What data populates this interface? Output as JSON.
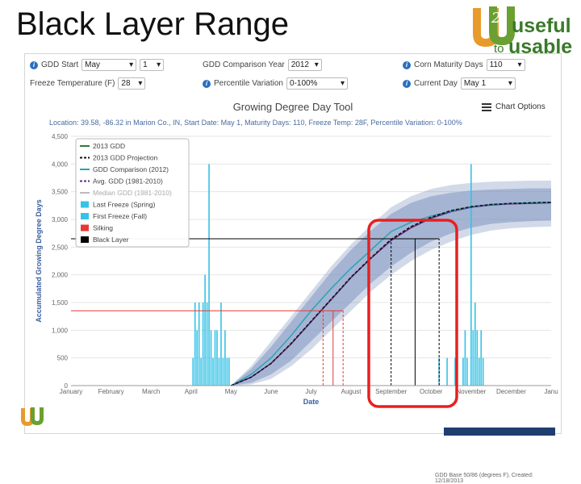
{
  "slide": {
    "title": "Black Layer Range"
  },
  "logo": {
    "word1": "useful",
    "word2": "to",
    "word3": "usable"
  },
  "controls": {
    "gdd_start_label": "GDD Start",
    "gdd_start_month": "May",
    "gdd_start_day": "1",
    "comparison_year_label": "GDD Comparison Year",
    "comparison_year": "2012",
    "maturity_label": "Corn Maturity Days",
    "maturity_days": "110",
    "freeze_label": "Freeze Temperature (F)",
    "freeze_temp": "28",
    "percentile_label": "Percentile Variation",
    "percentile": "0-100%",
    "current_day_label": "Current Day",
    "current_day": "May 1"
  },
  "tool": {
    "title": "Growing Degree Day Tool",
    "chart_options_label": "Chart Options",
    "subtitle": "Location: 39.58, -86.32 in Marion Co., IN, Start Date: May 1, Maturity Days: 110, Freeze Temp: 28F, Percentile Variation: 0-100%",
    "footer": "GDD Base 50/86 (degrees F), Created: 12/18/2013"
  },
  "colors": {
    "gdd_2013": "#2e7d32",
    "projection": "#111111",
    "comparison": "#29a3b8",
    "avg_gdd": "#5b2a86",
    "median": "#bbbbbb",
    "spring_freeze": "#33c3e6",
    "fall_freeze": "#33c3e6",
    "silking": "#e53935",
    "black_layer": "#000000",
    "band": "#7f95c0",
    "highlight": "#e8201f"
  },
  "chart_data": {
    "type": "line",
    "title": "Growing Degree Day Tool",
    "xlabel": "Date",
    "ylabel": "Accumulated Growing Degree Days",
    "ylim": [
      0,
      4500
    ],
    "yticks": [
      0,
      500,
      1000,
      1500,
      2000,
      2500,
      3000,
      3500,
      4000,
      4500
    ],
    "xlim": [
      0,
      12
    ],
    "months": [
      "January",
      "February",
      "March",
      "April",
      "May",
      "June",
      "July",
      "August",
      "September",
      "October",
      "November",
      "December",
      "Janu"
    ],
    "grid": true,
    "legend_placement": "top-left",
    "legend": [
      "2013 GDD",
      "2013 GDD Projection",
      "GDD Comparison (2012)",
      "Avg. GDD (1981-2010)",
      "Median GDD (1981-2010)",
      "Last Freeze (Spring)",
      "First Freeze (Fall)",
      "Silking",
      "Black Layer"
    ],
    "series": [
      {
        "name": "Avg. GDD (1981-2010)",
        "x": [
          4.0,
          4.5,
          5.0,
          5.5,
          6.0,
          6.5,
          7.0,
          7.5,
          8.0,
          8.5,
          9.0,
          9.5,
          10.0,
          10.5,
          11.0,
          11.5,
          12.0
        ],
        "y": [
          0,
          150,
          400,
          750,
          1150,
          1550,
          1950,
          2300,
          2620,
          2850,
          3020,
          3140,
          3220,
          3260,
          3280,
          3290,
          3300
        ]
      },
      {
        "name": "GDD Comparison (2012)",
        "x": [
          4.0,
          4.5,
          5.0,
          5.5,
          6.0,
          6.5,
          7.0,
          7.5,
          8.0,
          8.5,
          9.0,
          9.5,
          10.0,
          10.5,
          11.0,
          11.5,
          12.0
        ],
        "y": [
          0,
          200,
          500,
          900,
          1350,
          1750,
          2120,
          2450,
          2780,
          2950,
          3060,
          3150,
          3230,
          3270,
          3290,
          3300,
          3310
        ]
      },
      {
        "name": "2013 GDD Projection",
        "x": [
          4.0,
          4.5,
          5.0,
          5.5,
          6.0,
          6.5,
          7.0,
          7.5,
          8.0,
          8.5,
          9.0,
          9.5,
          10.0,
          10.5,
          11.0,
          11.5,
          12.0
        ],
        "y": [
          0,
          150,
          400,
          760,
          1160,
          1560,
          1960,
          2310,
          2640,
          2870,
          3040,
          3160,
          3230,
          3270,
          3290,
          3300,
          3310
        ]
      }
    ],
    "band_upper": {
      "x": [
        4.0,
        4.5,
        5.0,
        5.5,
        6.0,
        6.5,
        7.0,
        7.5,
        8.0,
        8.5,
        9.0,
        9.5,
        10.0,
        10.5,
        11.0,
        11.5,
        12.0
      ],
      "y": [
        0,
        300,
        700,
        1150,
        1600,
        2050,
        2450,
        2800,
        3100,
        3300,
        3420,
        3480,
        3520,
        3540,
        3550,
        3560,
        3560
      ]
    },
    "band_lower": {
      "x": [
        4.0,
        4.5,
        5.0,
        5.5,
        6.0,
        6.5,
        7.0,
        7.5,
        8.0,
        8.5,
        9.0,
        9.5,
        10.0,
        10.5,
        11.0,
        11.5,
        12.0
      ],
      "y": [
        0,
        50,
        200,
        450,
        800,
        1150,
        1500,
        1850,
        2150,
        2400,
        2600,
        2750,
        2850,
        2920,
        2950,
        2970,
        2980
      ]
    },
    "band_outer_upper": {
      "x": [
        4.0,
        4.5,
        5.0,
        5.5,
        6.0,
        6.5,
        7.0,
        7.5,
        8.0,
        8.5,
        9.0,
        9.5,
        10.0,
        10.5,
        11.0,
        11.5,
        12.0
      ],
      "y": [
        0,
        350,
        800,
        1250,
        1700,
        2150,
        2550,
        2900,
        3220,
        3420,
        3550,
        3620,
        3660,
        3680,
        3690,
        3700,
        3700
      ]
    },
    "band_outer_lower": {
      "x": [
        4.0,
        4.5,
        5.0,
        5.5,
        6.0,
        6.5,
        7.0,
        7.5,
        8.0,
        8.5,
        9.0,
        9.5,
        10.0,
        10.5,
        11.0,
        11.5,
        12.0
      ],
      "y": [
        0,
        20,
        120,
        350,
        650,
        1000,
        1350,
        1700,
        2000,
        2250,
        2450,
        2600,
        2720,
        2800,
        2840,
        2860,
        2870
      ]
    },
    "spring_freeze_bars": {
      "x": [
        3.05,
        3.1,
        3.15,
        3.2,
        3.25,
        3.3,
        3.35,
        3.4,
        3.45,
        3.5,
        3.55,
        3.6,
        3.65,
        3.7,
        3.75,
        3.8,
        3.85,
        3.9,
        3.95
      ],
      "y": [
        500,
        1500,
        1000,
        1500,
        500,
        1500,
        2000,
        1500,
        4000,
        1000,
        500,
        1000,
        1000,
        500,
        1500,
        500,
        1000,
        500,
        500
      ]
    },
    "fall_freeze_bars": {
      "x": [
        9.2,
        9.4,
        9.6,
        9.8,
        9.85,
        9.9,
        10.0,
        10.05,
        10.1,
        10.15,
        10.2,
        10.25,
        10.3
      ],
      "y": [
        500,
        500,
        500,
        500,
        1000,
        500,
        4000,
        1000,
        1500,
        1000,
        500,
        1000,
        500
      ]
    },
    "silking_lines": {
      "x": [
        6.3,
        6.55,
        6.8
      ],
      "y": [
        1350,
        1350,
        1350
      ],
      "style": [
        "dashed",
        "solid",
        "dashed"
      ]
    },
    "black_layer_lines": {
      "x": [
        8.0,
        8.6,
        9.2
      ],
      "y": [
        2650,
        2650,
        2650
      ],
      "style": [
        "dashed",
        "solid",
        "dashed"
      ]
    }
  }
}
